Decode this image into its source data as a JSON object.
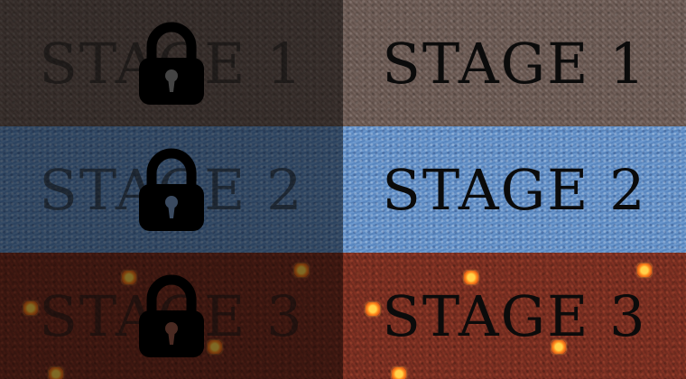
{
  "stages": [
    {
      "label": "STAGE 1",
      "theme": "stone",
      "texture_color": "#6e5c55"
    },
    {
      "label": "STAGE 2",
      "theme": "water",
      "texture_color": "#5f8fc9"
    },
    {
      "label": "STAGE 3",
      "theme": "lava",
      "texture_color": "#7a2f22"
    }
  ],
  "locked_preview_icon": "lock-icon",
  "ember_icon": "ember-icon"
}
